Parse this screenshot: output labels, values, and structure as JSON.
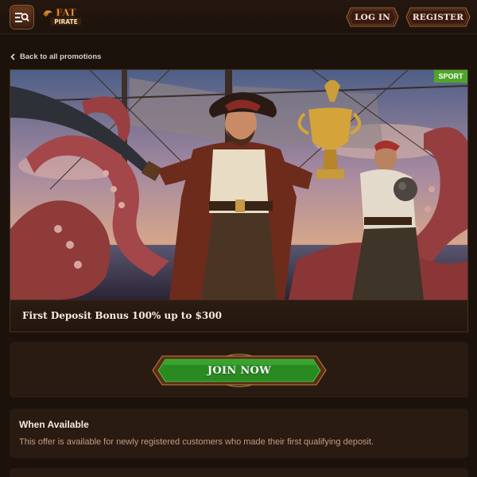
{
  "header": {
    "logo_text_top": "FAT",
    "logo_text_bottom": "PIRATE",
    "menu_icon": "menu-search-icon",
    "login_label": "LOG IN",
    "register_label": "REGISTER"
  },
  "nav": {
    "back_label": "Back to all promotions",
    "back_icon": "chevron-left-icon"
  },
  "promo": {
    "badge": "SPORT",
    "badge_color": "#4fa52a",
    "title": "First Deposit Bonus 100% up to $300"
  },
  "join": {
    "label": "JOIN NOW",
    "color": "#2a8a22"
  },
  "availability": {
    "title": "When Available",
    "text": "This offer is available for newly registered customers who made their first qualifying deposit."
  },
  "colors": {
    "background": "#1c120c",
    "panel": "#2a1b12",
    "accent": "#e7a23a"
  }
}
